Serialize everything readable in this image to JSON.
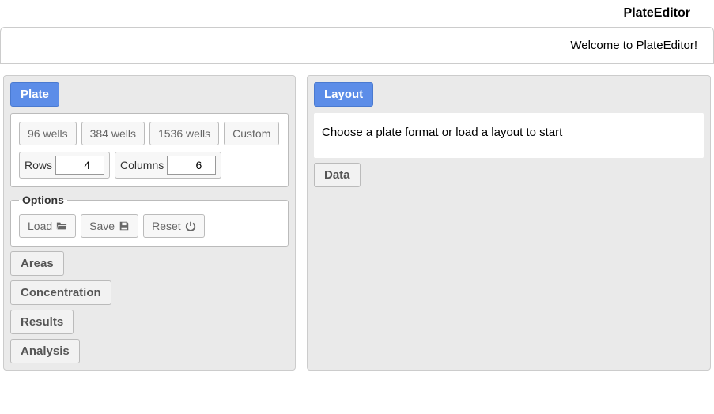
{
  "header": {
    "title": "PlateEditor"
  },
  "welcome": {
    "text": "Welcome to PlateEditor!"
  },
  "left": {
    "tabs": {
      "plate": "Plate",
      "areas": "Areas",
      "concentration": "Concentration",
      "results": "Results",
      "analysis": "Analysis"
    },
    "formats": {
      "wells96": "96 wells",
      "wells384": "384 wells",
      "wells1536": "1536 wells",
      "custom": "Custom"
    },
    "dims": {
      "rows_label": "Rows",
      "rows_value": "4",
      "cols_label": "Columns",
      "cols_value": "6"
    },
    "options": {
      "legend": "Options",
      "load": "Load",
      "save": "Save",
      "reset": "Reset"
    }
  },
  "right": {
    "layout_tab": "Layout",
    "data_tab": "Data",
    "message": "Choose a plate format or load a layout to start"
  }
}
